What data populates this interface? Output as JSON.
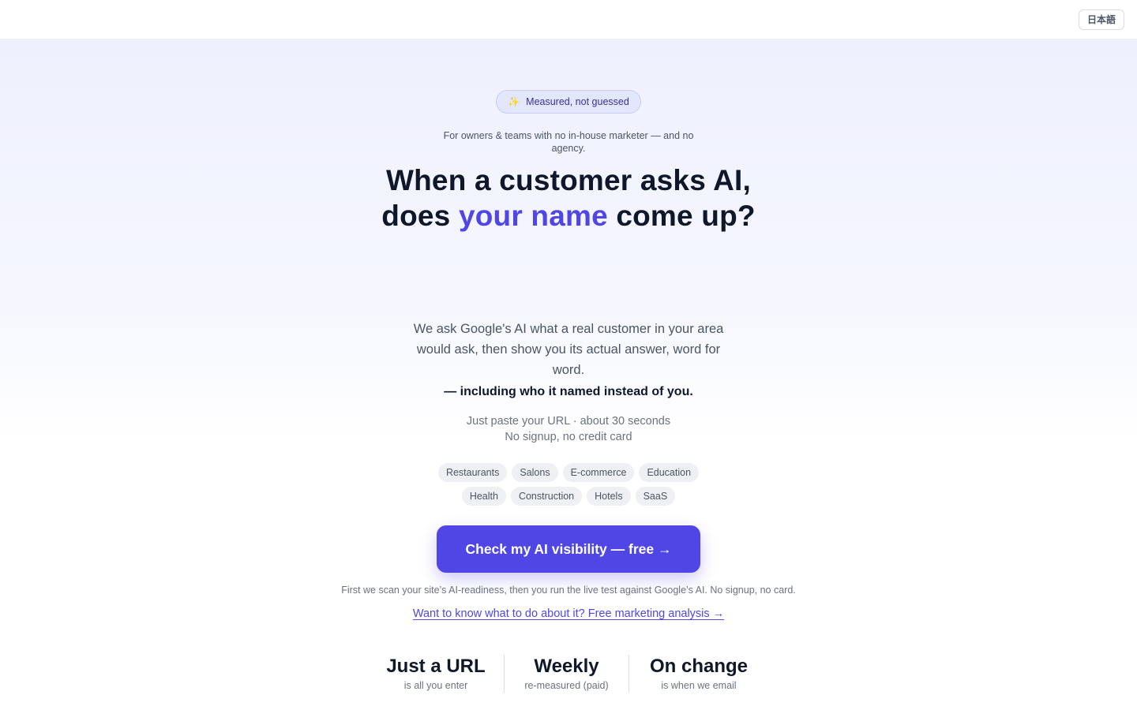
{
  "header": {
    "language_button": "日本語"
  },
  "hero": {
    "badge": {
      "icon": "sparkles-icon",
      "label": "Measured, not guessed"
    },
    "audience": "For owners & teams with no in-house marketer — and no agency.",
    "headline": {
      "line1": "When a customer asks AI,",
      "line2_pre": "does ",
      "line2_accent": "your name",
      "line2_post": " come up?"
    },
    "description": "We ask Google's AI what a real customer in your area would ask, then show you its actual answer, word for word.",
    "description_strong": "— including who it named instead of you.",
    "meta_line1": "Just paste your URL · about 30 seconds",
    "meta_line2": "No signup, no credit card",
    "industries_row1": [
      "Restaurants",
      "Salons",
      "E-commerce",
      "Education"
    ],
    "industries_row2": [
      "Health",
      "Construction",
      "Hotels",
      "SaaS"
    ],
    "cta_label": "Check my AI visibility — free →",
    "note": "First we scan your site’s AI-readiness, then you run the live test against Google’s AI. No signup, no card.",
    "secondary_link": "Want to know what to do about it? Free marketing analysis →"
  },
  "stats": [
    {
      "big": "Just a URL",
      "small": "is all you enter"
    },
    {
      "big": "Weekly",
      "small": "re-measured (paid)"
    },
    {
      "big": "On change",
      "small": "is when we email"
    }
  ],
  "colors": {
    "accent": "#4f46e5",
    "heading": "#0f172a",
    "muted": "#6b7280"
  }
}
